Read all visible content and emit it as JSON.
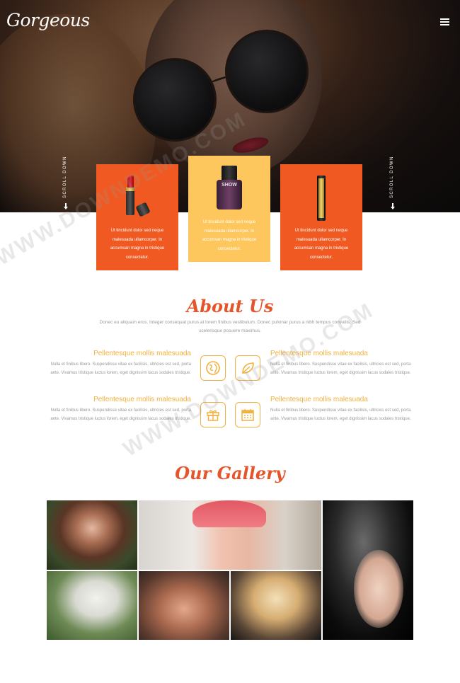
{
  "site": {
    "logo": "Gorgeous"
  },
  "hero": {
    "scroll_left": "SCROLL DOWN",
    "scroll_right": "SCROLL DOWN"
  },
  "products": [
    {
      "name": "lipstick",
      "text": "Ut tincidunt dolor sed neque malesuada ullamcorper. In accumsan magna in tristique consectetur.",
      "color": "#f05a22"
    },
    {
      "name": "nail-polish",
      "label": "SHOW",
      "text": "Ut tincidunt dolor sed neque malesuada ullamcorper. In accumsan magna in tristique consectetur.",
      "color": "#fdc75d"
    },
    {
      "name": "mascara",
      "text": "Ut tincidunt dolor sed neque malesuada ullamcorper. In accumsan magna in tristique consectetur.",
      "color": "#f05a22"
    }
  ],
  "about": {
    "title": "About Us",
    "intro": "Donec eu aliquam eros. Integer consequat purus at lorem finibus vestibulum. Donec pulvinar purus a nibh tempus convallis. Sed scelerisque posuere maximus.",
    "features": [
      {
        "title": "Pellentesque mollis malesuada",
        "text": "Nulla et finibus libero. Suspendisse vitae ex facilisis, ultricies est sed, porta ante. Vivamus tristique luctus lorem, eget dignissim lacus sodales tristique."
      },
      {
        "title": "Pellentesque mollis malesuada",
        "text": "Nulla et finibus libero. Suspendisse vitae ex facilisis, ultricies est sed, porta ante. Vivamus tristique luctus lorem, eget dignissim lacus sodales tristique."
      },
      {
        "title": "Pellentesque mollis malesuada",
        "text": "Nulla et finibus libero. Suspendisse vitae ex facilisis, ultricies est sed, porta ante. Vivamus tristique luctus lorem, eget dignissim lacus sodales tristique."
      },
      {
        "title": "Pellentesque mollis malesuada",
        "text": "Nulla et finibus libero. Suspendisse vitae ex facilisis, ultricies est sed, porta ante. Vivamus tristique luctus lorem, eget dignissim lacus sodales tristique."
      }
    ],
    "icons": [
      "globe-icon",
      "leaf-icon",
      "gift-icon",
      "calendar-icon"
    ],
    "accent": "#f2b03e"
  },
  "gallery": {
    "title": "Our Gallery"
  },
  "watermark": "WWW.DOWNDEMO.COM",
  "colors": {
    "brand": "#e5552b",
    "orange": "#f05a22",
    "yellow": "#fdc75d"
  }
}
